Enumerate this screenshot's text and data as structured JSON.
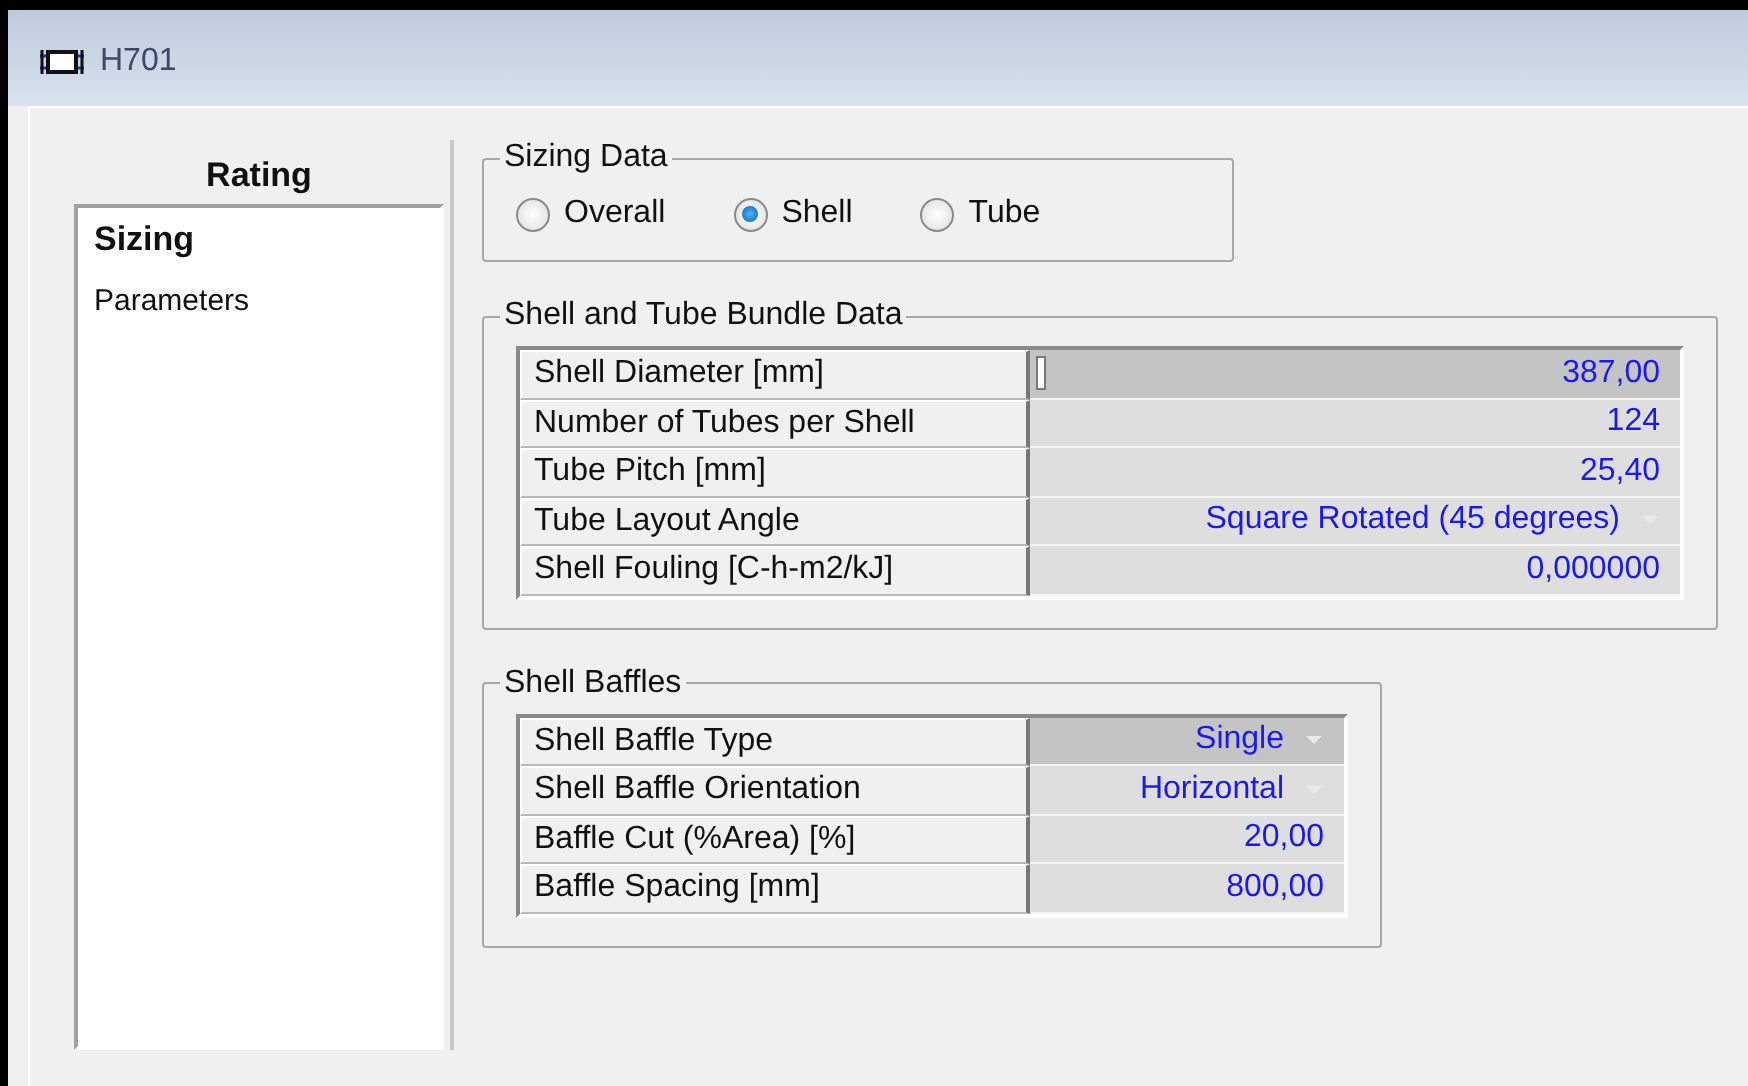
{
  "window": {
    "title": "H701"
  },
  "sidebar": {
    "header": "Rating",
    "items": [
      {
        "label": "Sizing",
        "selected": true
      },
      {
        "label": "Parameters",
        "selected": false
      }
    ]
  },
  "sizing_data": {
    "title": "Sizing Data",
    "options": [
      {
        "label": "Overall",
        "selected": false
      },
      {
        "label": "Shell",
        "selected": true
      },
      {
        "label": "Tube",
        "selected": false
      }
    ]
  },
  "bundle": {
    "title": "Shell and Tube Bundle Data",
    "rows": [
      {
        "label": "Shell Diameter [mm]",
        "value": "387,00",
        "kind": "number",
        "selected": true
      },
      {
        "label": "Number of Tubes per Shell",
        "value": "124",
        "kind": "number",
        "selected": false
      },
      {
        "label": "Tube Pitch [mm]",
        "value": "25,40",
        "kind": "number",
        "selected": false
      },
      {
        "label": "Tube Layout Angle",
        "value": "Square Rotated (45 degrees)",
        "kind": "dropdown",
        "selected": false
      },
      {
        "label": "Shell Fouling [C-h-m2/kJ]",
        "value": "0,000000",
        "kind": "number",
        "selected": false
      }
    ]
  },
  "baffles": {
    "title": "Shell Baffles",
    "rows": [
      {
        "label": "Shell Baffle Type",
        "value": "Single",
        "kind": "dropdown",
        "selected": true
      },
      {
        "label": "Shell Baffle Orientation",
        "value": "Horizontal",
        "kind": "dropdown",
        "selected": false
      },
      {
        "label": "Baffle Cut (%Area) [%]",
        "value": "20,00",
        "kind": "number",
        "selected": false
      },
      {
        "label": "Baffle Spacing [mm]",
        "value": "800,00",
        "kind": "number",
        "selected": false
      }
    ]
  }
}
